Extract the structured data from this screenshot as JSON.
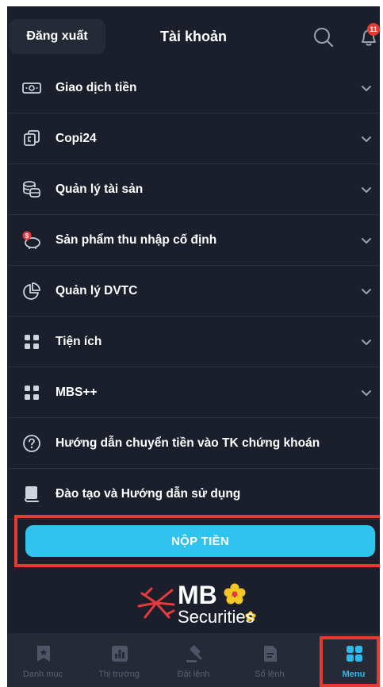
{
  "header": {
    "logout_label": "Đăng xuất",
    "title": "Tài khoản",
    "notification_count": "11"
  },
  "menu": {
    "items": [
      {
        "label": "Giao dịch tiền",
        "icon": "cash-icon",
        "expandable": true
      },
      {
        "label": "Copi24",
        "icon": "copy-icon",
        "expandable": true
      },
      {
        "label": "Quản lý tài sản",
        "icon": "coins-icon",
        "expandable": true
      },
      {
        "label": "Sản phẩm thu nhập cố định",
        "icon": "piggy-bank-icon",
        "expandable": true
      },
      {
        "label": "Quản lý DVTC",
        "icon": "pie-chart-icon",
        "expandable": true
      },
      {
        "label": "Tiện ích",
        "icon": "grid-icon",
        "expandable": true
      },
      {
        "label": "MBS++",
        "icon": "grid-icon",
        "expandable": true
      },
      {
        "label": "Hướng dẫn chuyển tiền vào TK chứng khoán",
        "icon": "help-icon",
        "expandable": false
      },
      {
        "label": "Đào tạo và Hướng dẫn sử dụng",
        "icon": "book-icon",
        "expandable": false
      }
    ]
  },
  "deposit": {
    "label": "NỘP TIỀN"
  },
  "logo": {
    "brand": "MB",
    "sub": "Securities"
  },
  "bottom_nav": {
    "items": [
      {
        "label": "Danh mục",
        "icon": "bookmark-icon",
        "active": false
      },
      {
        "label": "Thị trường",
        "icon": "market-chart-icon",
        "active": false
      },
      {
        "label": "Đặt lệnh",
        "icon": "gavel-icon",
        "active": false
      },
      {
        "label": "Sổ lệnh",
        "icon": "order-book-icon",
        "active": false
      },
      {
        "label": "Menu",
        "icon": "menu-grid-icon",
        "active": true
      }
    ]
  },
  "colors": {
    "background": "#1b1f2b",
    "accent": "#2fc3ee",
    "highlight": "#e53a2f",
    "inactive": "#5b6172"
  }
}
